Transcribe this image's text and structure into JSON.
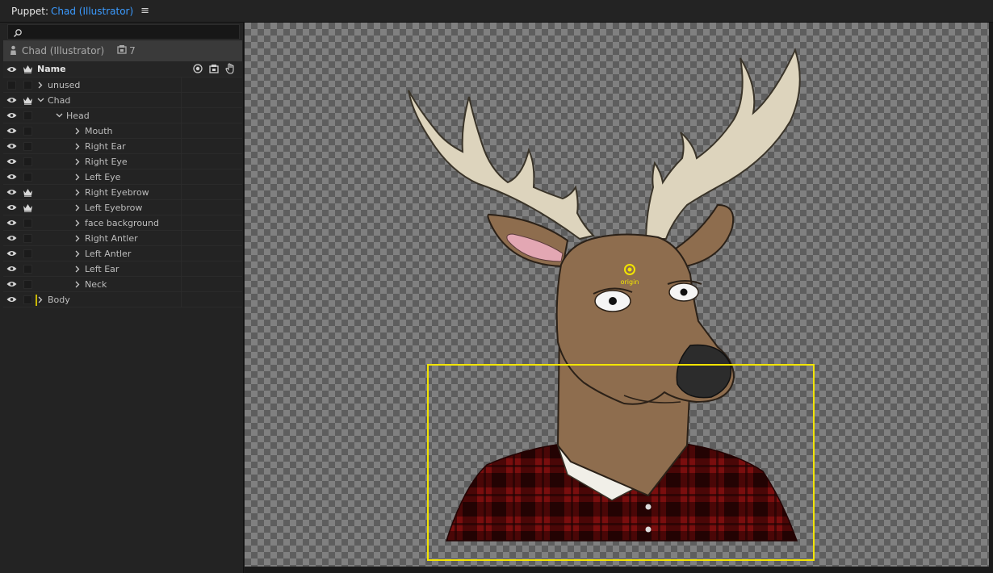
{
  "titlebar": {
    "label": "Puppet:",
    "document": "Chad (Illustrator)",
    "menu_icon": "hamburger-icon"
  },
  "search": {
    "placeholder": ""
  },
  "puppet": {
    "name": "Chad (Illustrator)",
    "count": "7"
  },
  "header": {
    "name_label": "Name"
  },
  "tree": [
    {
      "label": "unused",
      "depth": 0,
      "expanded": false,
      "eye": false,
      "crown": false
    },
    {
      "label": "Chad",
      "depth": 0,
      "expanded": true,
      "eye": true,
      "crown": true
    },
    {
      "label": "Head",
      "depth": 1,
      "expanded": true,
      "eye": true,
      "crown": false
    },
    {
      "label": "Mouth",
      "depth": 2,
      "expanded": false,
      "eye": true,
      "crown": false
    },
    {
      "label": "Right Ear",
      "depth": 2,
      "expanded": false,
      "eye": true,
      "crown": false
    },
    {
      "label": "Right Eye",
      "depth": 2,
      "expanded": false,
      "eye": true,
      "crown": false
    },
    {
      "label": "Left Eye",
      "depth": 2,
      "expanded": false,
      "eye": true,
      "crown": false
    },
    {
      "label": "Right Eyebrow",
      "depth": 2,
      "expanded": false,
      "eye": true,
      "crown": true
    },
    {
      "label": "Left Eyebrow",
      "depth": 2,
      "expanded": false,
      "eye": true,
      "crown": true
    },
    {
      "label": "face background",
      "depth": 2,
      "expanded": false,
      "eye": true,
      "crown": false
    },
    {
      "label": "Right Antler",
      "depth": 2,
      "expanded": false,
      "eye": true,
      "crown": false
    },
    {
      "label": "Left Antler",
      "depth": 2,
      "expanded": false,
      "eye": true,
      "crown": false
    },
    {
      "label": "Left Ear",
      "depth": 2,
      "expanded": false,
      "eye": true,
      "crown": false
    },
    {
      "label": "Neck",
      "depth": 2,
      "expanded": false,
      "eye": true,
      "crown": false
    },
    {
      "label": "Body",
      "depth": 0,
      "expanded": false,
      "eye": true,
      "crown": false,
      "marker": true
    }
  ],
  "canvas": {
    "origin_label": "origin"
  },
  "colors": {
    "accent": "#3b9bff",
    "selection": "#f2e400",
    "plaid": "#6a0c0c",
    "fur": "#8e6d4e",
    "antler": "#ddd4bd"
  }
}
